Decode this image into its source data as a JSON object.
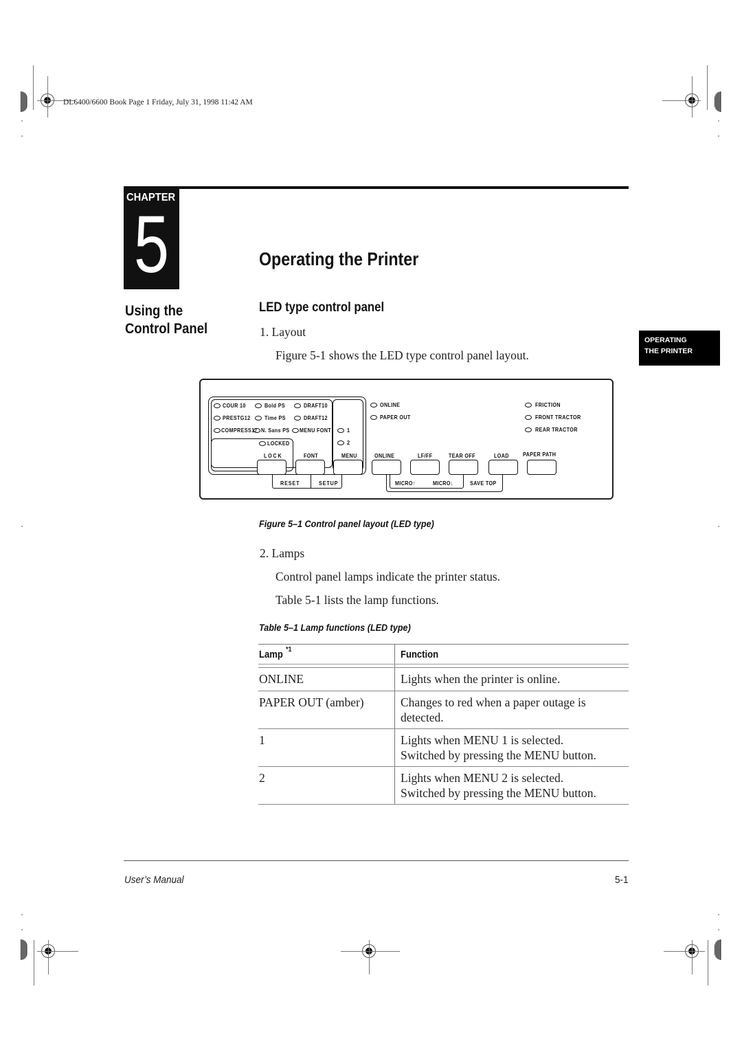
{
  "print_stamp": "DL6400/6600 Book  Page 1  Friday, July 31, 1998  11:42 AM",
  "chapter": {
    "label": "CHAPTER",
    "number": "5"
  },
  "page_title": "Operating the Printer",
  "side_heading": [
    "Using the",
    "Control Panel"
  ],
  "thumb_tab": [
    "OPERATING",
    "THE PRINTER"
  ],
  "section": {
    "heading": "LED type control panel",
    "item1": "1.  Layout",
    "item1_text": "Figure 5-1 shows the LED type control panel layout.",
    "item2": "2.  Lamps",
    "item2_text1": "Control panel lamps indicate the printer status.",
    "item2_text2": "Table 5-1 lists the lamp functions."
  },
  "figure": {
    "caption": "Figure 5–1    Control panel layout (LED type)",
    "font_leds": [
      "COUR 10",
      "Bold PS",
      "DRAFT10",
      "PRESTG12",
      "Time PS",
      "DRAFT12",
      "COMPRESS17",
      "N. Sans PS",
      "MENU FONT"
    ],
    "locked_led": "LOCKED",
    "menu_leds": [
      "1",
      "2"
    ],
    "status_leds": [
      "ONLINE",
      "PAPER OUT"
    ],
    "path_leds": [
      "FRICTION",
      "FRONT TRACTOR",
      "REAR TRACTOR"
    ],
    "buttons": [
      "LOCK",
      "FONT",
      "MENU",
      "ONLINE",
      "LF/FF",
      "TEAR OFF",
      "LOAD",
      "PAPER PATH"
    ],
    "secondary_labels": [
      "RESET",
      "SETUP",
      "MICRO↑",
      "MICRO↓",
      "SAVE TOP"
    ]
  },
  "table": {
    "caption": "Table 5–1    Lamp functions (LED type)",
    "headers": {
      "lamp": "Lamp",
      "lamp_note": "*1",
      "function": "Function"
    },
    "rows": [
      {
        "lamp": "ONLINE",
        "function": [
          "Lights when the printer is online."
        ]
      },
      {
        "lamp": "PAPER OUT (amber)",
        "function": [
          "Changes to red when a paper outage is",
          "detected."
        ]
      },
      {
        "lamp": "1",
        "function": [
          "Lights when MENU 1 is selected.",
          "Switched by pressing the MENU button."
        ]
      },
      {
        "lamp": "2",
        "function": [
          "Lights when MENU 2 is selected.",
          "Switched by pressing the MENU button."
        ]
      }
    ]
  },
  "footer": {
    "left": "User’s Manual",
    "right": "5-1"
  }
}
